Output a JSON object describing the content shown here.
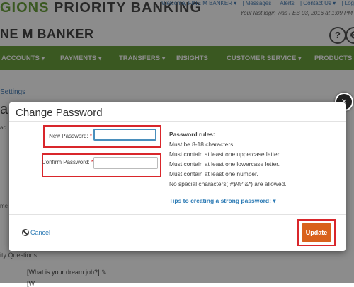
{
  "header": {
    "brand_left": "GIONS",
    "brand_right": "PRIORITY BANKING",
    "welcome": "Welcome, FINE M BANKER ▾",
    "messages": "| Messages",
    "alerts": "| Alerts",
    "contact": "| Contact Us ▾",
    "logout": "| Log",
    "last_login": "Your last login was FEB 03, 2016 at 1:09 PM",
    "account_name": "NE M BANKER",
    "help_icon_glyph": "?",
    "settings_icon_glyph": "⚙"
  },
  "nav": {
    "items": [
      "ACCOUNTS ▾",
      "PAYMENTS ▾",
      "TRANSFERS ▾",
      "INSIGHTS",
      "CUSTOMER SERVICE ▾",
      "PRODUCTS ▾"
    ]
  },
  "background": {
    "breadcrumb": "Settings",
    "heading": "a",
    "left_sliver_1": "ac",
    "left_sliver_2": "me",
    "security_questions": "ity Questions",
    "question_1": "[What is your dream job?]",
    "question_2": "[W"
  },
  "modal": {
    "title": "Change Password",
    "close_glyph": "×",
    "new_password_label": "New Password:",
    "confirm_password_label": "Confirm Password:",
    "required_marker": "*",
    "new_password_value": "",
    "confirm_password_value": "",
    "rules_title": "Password rules:",
    "rules": [
      "Must be 8-18 characters.",
      "Must contain at least one uppercase letter.",
      "Must contain at least one lowercase letter.",
      "Must contain at least one number.",
      "No special characters(!#$%^&*) are allowed."
    ],
    "tips_link": "Tips to creating a strong password: ▾",
    "cancel_label": "Cancel",
    "update_label": "Update"
  },
  "colors": {
    "brand_green": "#6aa13c",
    "highlight_red": "#d9262b",
    "update_orange": "#d9611b",
    "link_blue": "#2d7bb5"
  }
}
